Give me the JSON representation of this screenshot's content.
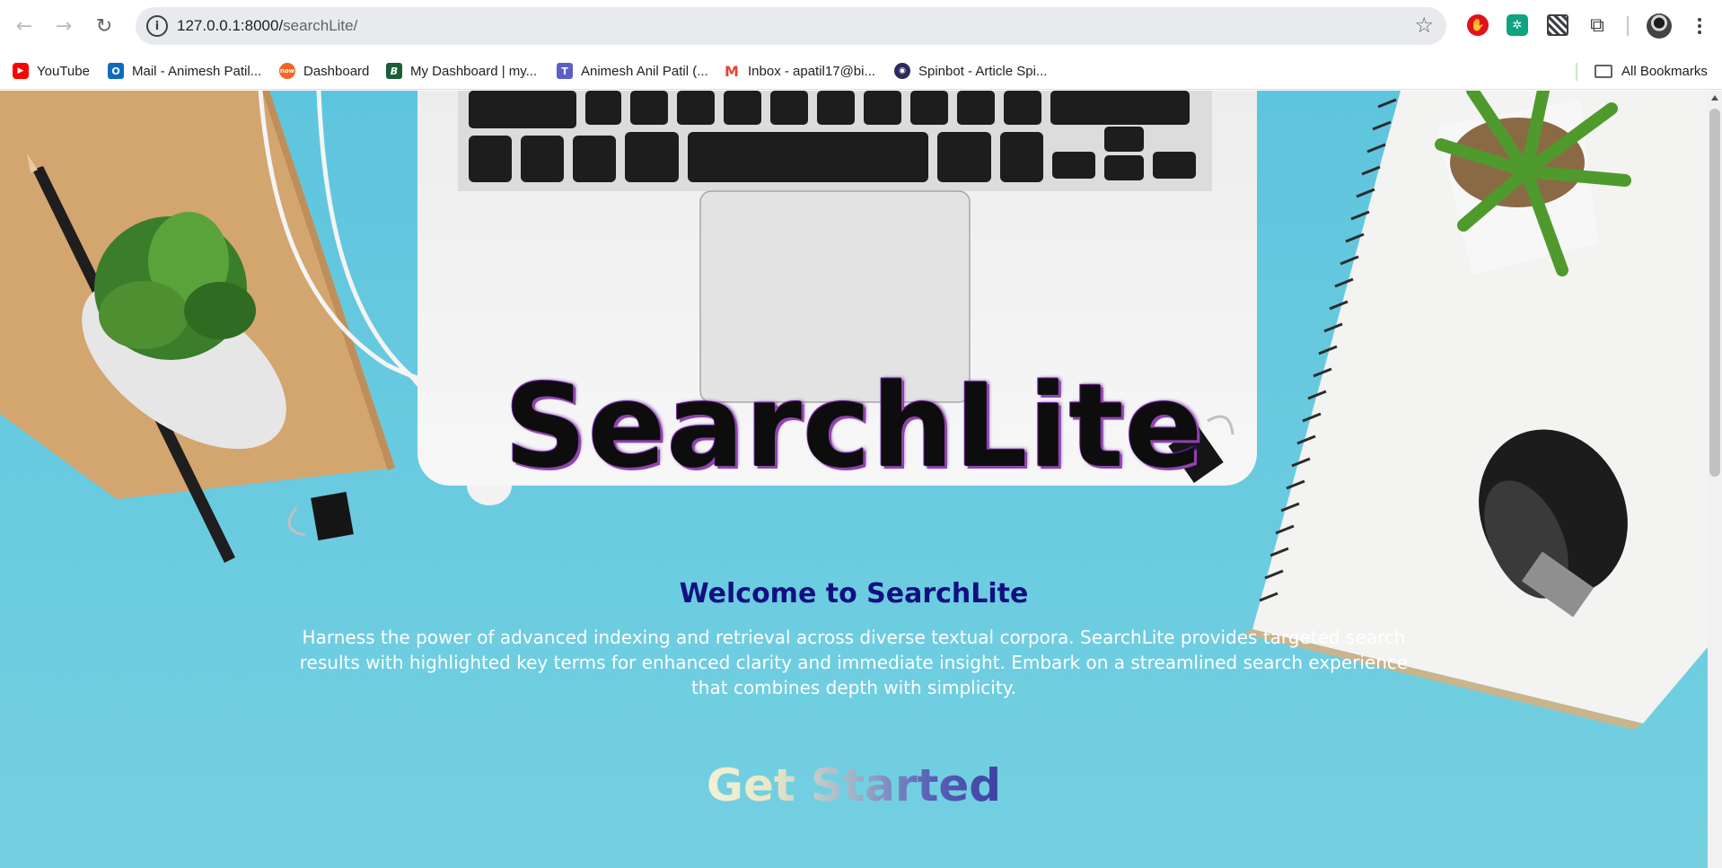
{
  "browser": {
    "url_host": "127.0.0.1:8000/",
    "url_path": "searchLite/",
    "icons": {
      "back": "arrow-left-icon",
      "forward": "arrow-right-icon",
      "reload": "reload-icon",
      "site_info": "info-icon",
      "bookmark": "star-icon",
      "menu": "more-vert-icon"
    }
  },
  "bookmarks": [
    {
      "label": "YouTube",
      "icon": "youtube-icon"
    },
    {
      "label": "Mail - Animesh Patil...",
      "icon": "outlook-icon"
    },
    {
      "label": "Dashboard",
      "icon": "now-icon"
    },
    {
      "label": "My Dashboard | my...",
      "icon": "blackboard-icon"
    },
    {
      "label": "Animesh Anil Patil (...",
      "icon": "teams-icon"
    },
    {
      "label": "Inbox - apatil17@bi...",
      "icon": "gmail-icon"
    },
    {
      "label": "Spinbot - Article Spi...",
      "icon": "spinbot-icon"
    }
  ],
  "all_bookmarks": "All Bookmarks",
  "page": {
    "title": "SearchLite",
    "welcome": "Welcome to SearchLite",
    "description": "Harness the power of advanced indexing and retrieval across diverse textual corpora. SearchLite provides targeted search results with highlighted key terms for enhanced clarity and immediate insight. Embark on a streamlined search experience that combines depth with simplicity.",
    "cta": "Get Started"
  },
  "colors": {
    "background": "#6fcde0",
    "title_glow": "#8e44ad",
    "welcome": "#101080",
    "description": "#ffffff"
  }
}
